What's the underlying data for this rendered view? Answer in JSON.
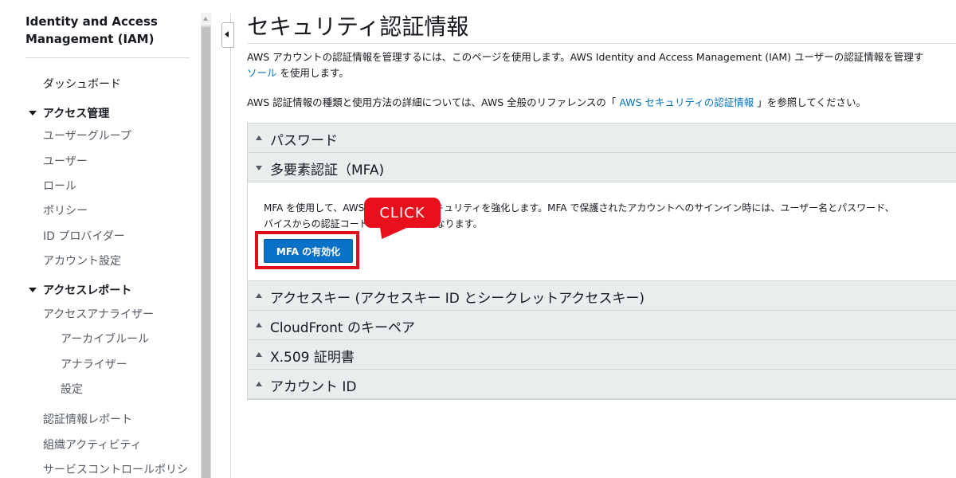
{
  "sidebar": {
    "title_line1": "Identity and Access",
    "title_line2": "Management (IAM)",
    "dashboard": "ダッシュボード",
    "access_management": "アクセス管理",
    "user_groups": "ユーザーグループ",
    "users": "ユーザー",
    "roles": "ロール",
    "policies": "ポリシー",
    "id_providers": "ID プロバイダー",
    "account_settings": "アカウント設定",
    "access_reports": "アクセスレポート",
    "access_analyzer": "アクセスアナライザー",
    "archive_rules": "アーカイブルール",
    "analyzers": "アナライザー",
    "settings": "設定",
    "credential_report": "認証情報レポート",
    "org_activity": "組織アクティビティ",
    "scp": "サービスコントロールポリシ"
  },
  "main": {
    "title": "セキュリティ認証情報",
    "intro_line1": "AWS アカウントの認証情報を管理するには、このページを使用します。AWS Identity and Access Management (IAM) ユーザーの認証情報を管理す",
    "intro_link": "ソール",
    "intro_line2_rest": " を使用します。",
    "ref_prefix": "AWS 認証情報の種類と使用方法の詳細については、AWS 全般のリファレンスの「 ",
    "ref_link": "AWS セキュリティの認証情報",
    "ref_suffix": " 」を参照してください。"
  },
  "accordion": {
    "password": "パスワード",
    "mfa": "多要素認証（MFA)",
    "mfa_text_line1": "MFA を使用して、AWS アカウントのセキュリティを強化します。MFA で保護されたアカウントへのサインイン時には、ユーザー名とパスワード、",
    "mfa_text_line2": "バイスからの認証コードの入力が必要になります。",
    "mfa_button": "MFA の有効化",
    "access_keys": "アクセスキー (アクセスキー ID とシークレットアクセスキー)",
    "cloudfront": "CloudFront のキーペア",
    "x509": "X.509 証明書",
    "account_id": "アカウント ID"
  },
  "annotation": {
    "callout": "CLICK"
  },
  "colors": {
    "primary_button": "#0a71c8",
    "highlight": "#e00d1b",
    "link": "#0073bb"
  }
}
